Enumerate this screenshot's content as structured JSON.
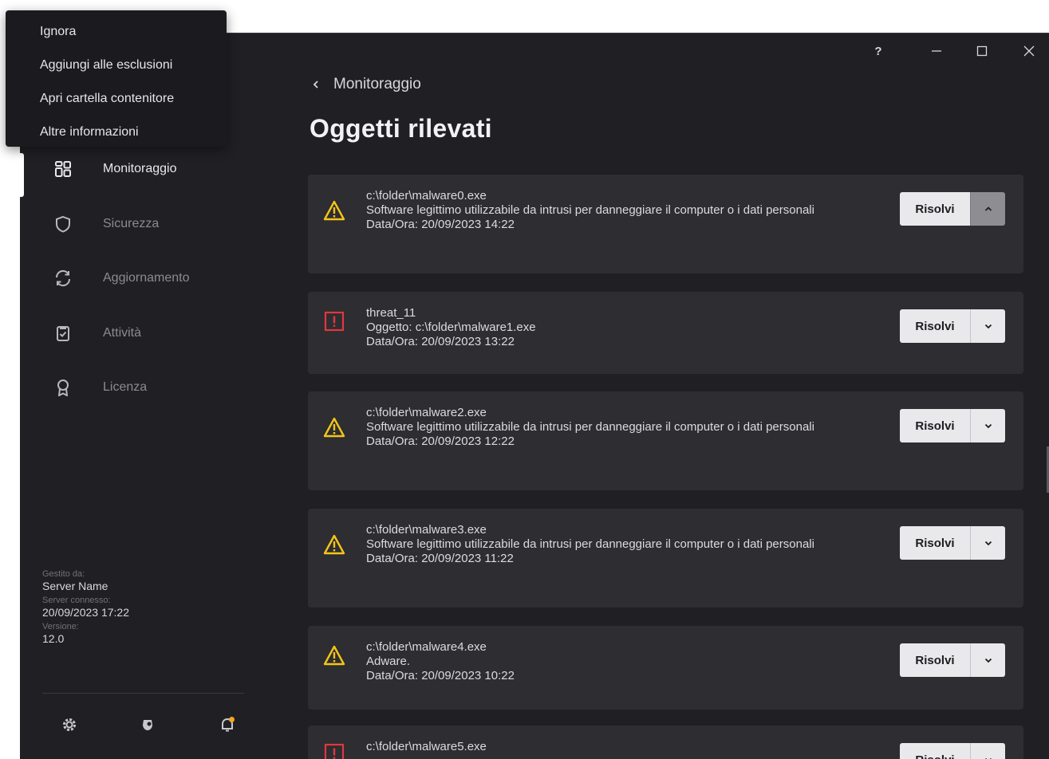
{
  "context_menu": {
    "items": [
      "Ignora",
      "Aggiungi alle esclusioni",
      "Apri cartella contenitore",
      "Altre informazioni"
    ]
  },
  "window_controls": {
    "help": "?"
  },
  "sidebar": {
    "items": [
      {
        "label": "Monitoraggio",
        "icon": "dashboard-icon",
        "active": true
      },
      {
        "label": "Sicurezza",
        "icon": "shield-icon",
        "active": false
      },
      {
        "label": "Aggiornamento",
        "icon": "refresh-icon",
        "active": false
      },
      {
        "label": "Attività",
        "icon": "clipboard-check-icon",
        "active": false
      },
      {
        "label": "Licenza",
        "icon": "award-icon",
        "active": false
      }
    ],
    "managed": {
      "managed_by_label": "Gestito da:",
      "server_name": "Server Name",
      "connected_label": "Server connesso:",
      "connected_value": "20/09/2023 17:22",
      "version_label": "Versione:",
      "version_value": "12.0"
    },
    "notification_color": "#f5a623"
  },
  "main": {
    "breadcrumb": "Monitoraggio",
    "title": "Oggetti rilevati",
    "resolve_label": "Risolvi",
    "cards": [
      {
        "severity": "warning",
        "name": "c:\\folder\\malware0.exe",
        "description": "Software legittimo utilizzabile da intrusi per danneggiare il computer o i dati personali",
        "datetime": "Data/Ora: 20/09/2023 14:22",
        "expanded": true
      },
      {
        "severity": "danger",
        "name": "threat_11",
        "description": "Oggetto: c:\\folder\\malware1.exe",
        "datetime": "Data/Ora: 20/09/2023 13:22",
        "expanded": false
      },
      {
        "severity": "warning",
        "name": "c:\\folder\\malware2.exe",
        "description": "Software legittimo utilizzabile da intrusi per danneggiare il computer o i dati personali",
        "datetime": "Data/Ora: 20/09/2023 12:22",
        "expanded": false
      },
      {
        "severity": "warning",
        "name": "c:\\folder\\malware3.exe",
        "description": "Software legittimo utilizzabile da intrusi per danneggiare il computer o i dati personali",
        "datetime": "Data/Ora: 20/09/2023 11:22",
        "expanded": false
      },
      {
        "severity": "warning",
        "name": "c:\\folder\\malware4.exe",
        "description": "Adware.",
        "datetime": "Data/Ora: 20/09/2023 10:22",
        "expanded": false
      },
      {
        "severity": "danger",
        "name": "c:\\folder\\malware5.exe",
        "description": "",
        "datetime": "",
        "expanded": false
      }
    ],
    "colors": {
      "warning": "#f5c518",
      "danger": "#e0383e"
    }
  }
}
